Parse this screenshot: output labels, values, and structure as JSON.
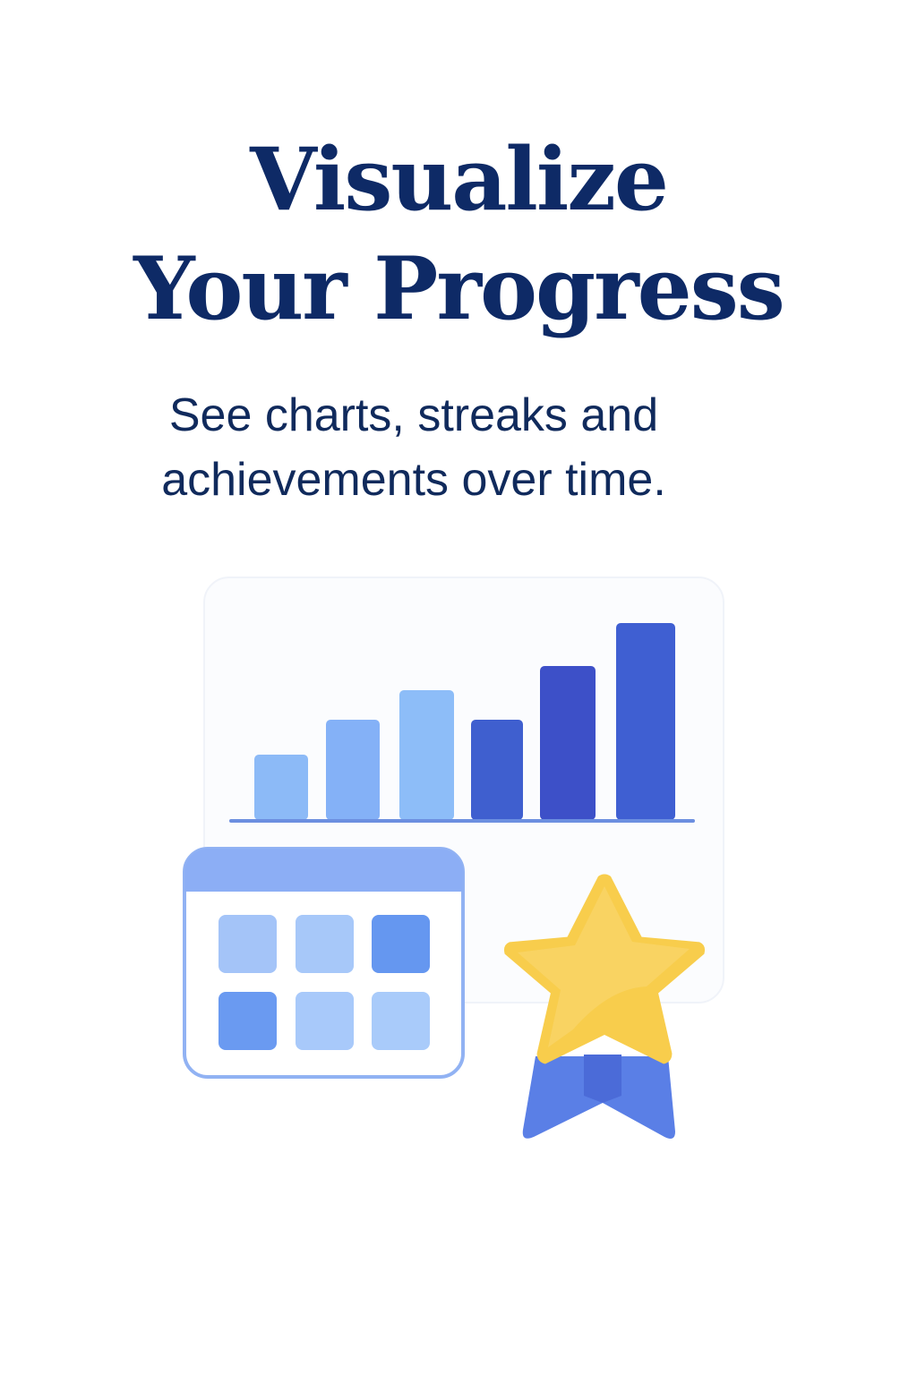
{
  "onboarding": {
    "title_line1": "Visualize",
    "title_line2": "Your Progress",
    "subtitle_line1": "See charts, streaks and",
    "subtitle_line2": "achievements over time."
  },
  "illustration": {
    "chart_icon": "bar-chart-icon",
    "calendar_icon": "calendar-icon",
    "award_icon": "star-award-icon",
    "bar_levels": [
      0.33,
      0.51,
      0.66,
      0.51,
      0.78,
      1.0
    ],
    "bar_colors": [
      "#8cbaf7",
      "#84b1f7",
      "#8dbdf8",
      "#3f5fcf",
      "#3d50c8",
      "#3f5fd2"
    ],
    "calendar_cell_colors": [
      "#a4c4f8",
      "#a7c8f9",
      "#6597f0",
      "#6a9af1",
      "#a8c9fa",
      "#a9cbfa"
    ]
  },
  "colors": {
    "title": "#0e2a66",
    "subtitle": "#102a5c",
    "chart_axis": "#6c8fe0",
    "calendar_header": "#8caef5",
    "calendar_border": "#91b2f3",
    "star": "#f8cd4c",
    "ribbon": "#5a7fe6"
  }
}
